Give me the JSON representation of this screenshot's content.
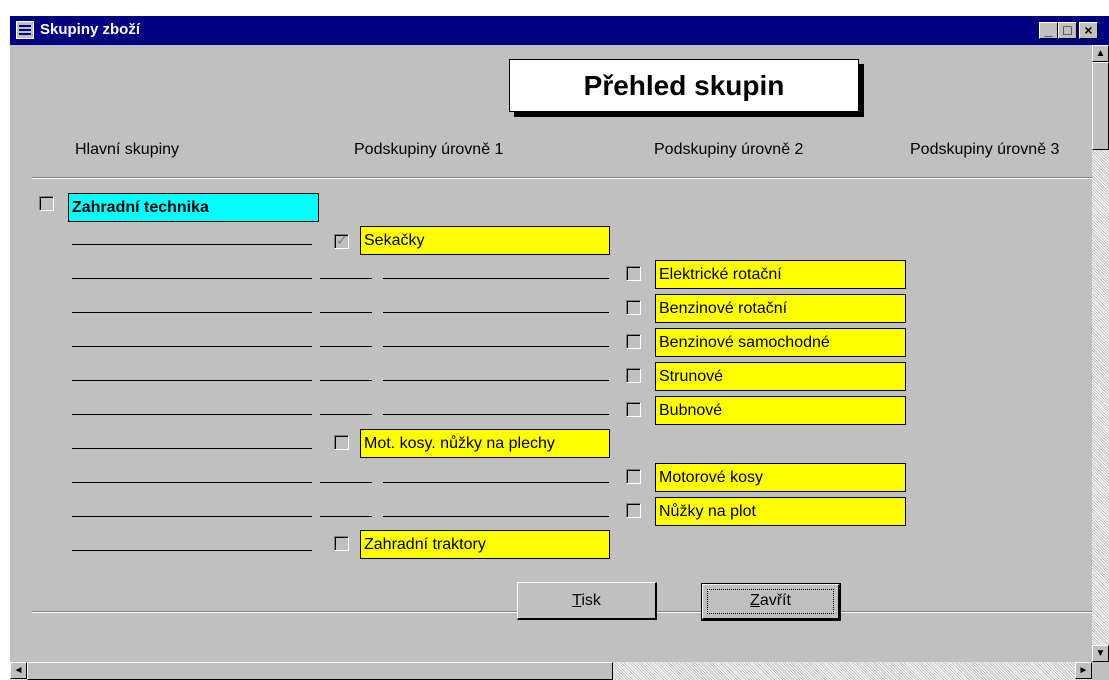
{
  "window": {
    "title": "Skupiny zboží",
    "controls": {
      "minimize": "_",
      "maximize": "□",
      "close": "×"
    }
  },
  "heading": "Přehled skupin",
  "columns": [
    "Hlavní skupiny",
    "Podskupiny úrovně 1",
    "Podskupiny úrovně 2",
    "Podskupiny úrovně 3"
  ],
  "main_group": {
    "label": "Zahradní technika",
    "checked": false
  },
  "level1": [
    {
      "label": "Sekačky",
      "checked": true
    },
    {
      "label": "Mot. kosy. nůžky na plechy",
      "checked": false
    },
    {
      "label": "Zahradní traktory",
      "checked": false
    }
  ],
  "level2": [
    {
      "label": "Elektrické rotační",
      "checked": false
    },
    {
      "label": "Benzinové rotační",
      "checked": false
    },
    {
      "label": "Benzinové samochodné",
      "checked": false
    },
    {
      "label": "Strunové",
      "checked": false
    },
    {
      "label": "Bubnové",
      "checked": false
    },
    {
      "label": "Motorové kosy",
      "checked": false
    },
    {
      "label": "Nůžky na plot",
      "checked": false
    }
  ],
  "buttons": {
    "print": {
      "label": "Tisk",
      "accel": "T"
    },
    "close": {
      "label": "Zavřít",
      "accel": "Z"
    }
  },
  "scrollbars": {
    "up": "▲",
    "down": "▼",
    "left": "◄",
    "right": "►"
  }
}
